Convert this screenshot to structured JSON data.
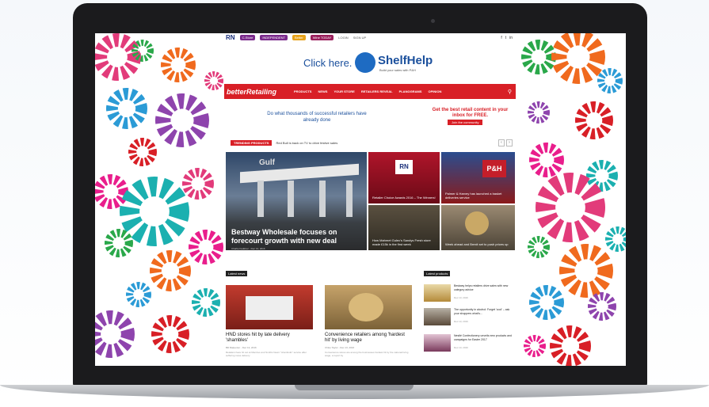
{
  "site": {
    "utility": {
      "logo": "RN",
      "pills": [
        "C-Store",
        "INDEPENDENT",
        "Better",
        "Wine TODAY"
      ],
      "links": [
        "LOGIN",
        "SIGN UP"
      ]
    },
    "banner": {
      "click": "Click here.",
      "brand": "ShelfHelp",
      "sub": "Build your sales with P&H"
    },
    "nav": {
      "brand": "betterRetailing",
      "items": [
        "PRODUCTS",
        "NEWS",
        "YOUR STORE",
        "RETAILERS REVEAL",
        "PLANOGRAMS",
        "OPINION"
      ]
    },
    "promo": {
      "left": "Do what thousands of successful retailers have already done",
      "right": "Get the best retail content in your inbox for FREE.",
      "button": "Join the community"
    },
    "trending": {
      "tag": "TRENDING PRODUCTS",
      "text": "Red Bull is back on TV to drive festive sales"
    },
    "hero": {
      "title": "Bestway Wholesale focuses on forecourt growth with new deal",
      "meta": "Charlie Faulkner - Dec 13, 2016"
    },
    "tiles": [
      {
        "caption": "Retailer Choice Awards 2016 – The Winners!"
      },
      {
        "caption": "Palmer & Harvey has launched a basket deliveries service"
      },
      {
        "caption": "How Mahmet Gulec's Sandys Fresh store made £15k in the first week"
      },
      {
        "caption": "Week ahead and Brexit set to push prices up"
      }
    ],
    "latest_news": {
      "heading": "Latest news",
      "cards": [
        {
          "title": "HND stores hit by late delivery 'shambles'",
          "meta": "Bill Malpenter - Dec 13, 2016",
          "excerpt": "Retailers have hit out at Menzies and Smiths News' \"shambolic\" service after suffering news delivery"
        },
        {
          "title": "Convenience retailers among 'hardest hit' by living wage",
          "meta": "Chloe Taylor - Dec 13, 2016",
          "excerpt": "Convenience stores are among the businesses hardest hit by the national living wage, a report by"
        }
      ]
    },
    "latest_products": {
      "heading": "Latest products",
      "items": [
        {
          "text": "Bestway helps retailers drive sales with new category advice",
          "date": "Dec 13, 2016"
        },
        {
          "text": "The opportunity in alcohol: Forget 'cool' – ask your shoppers what's...",
          "date": "Dec 13, 2016"
        },
        {
          "text": "Nestlé Confectionery unveils new products and campaigns for Easter 2017",
          "date": "Dec 13, 2016"
        }
      ]
    },
    "social": [
      "f",
      "t",
      "in"
    ]
  }
}
